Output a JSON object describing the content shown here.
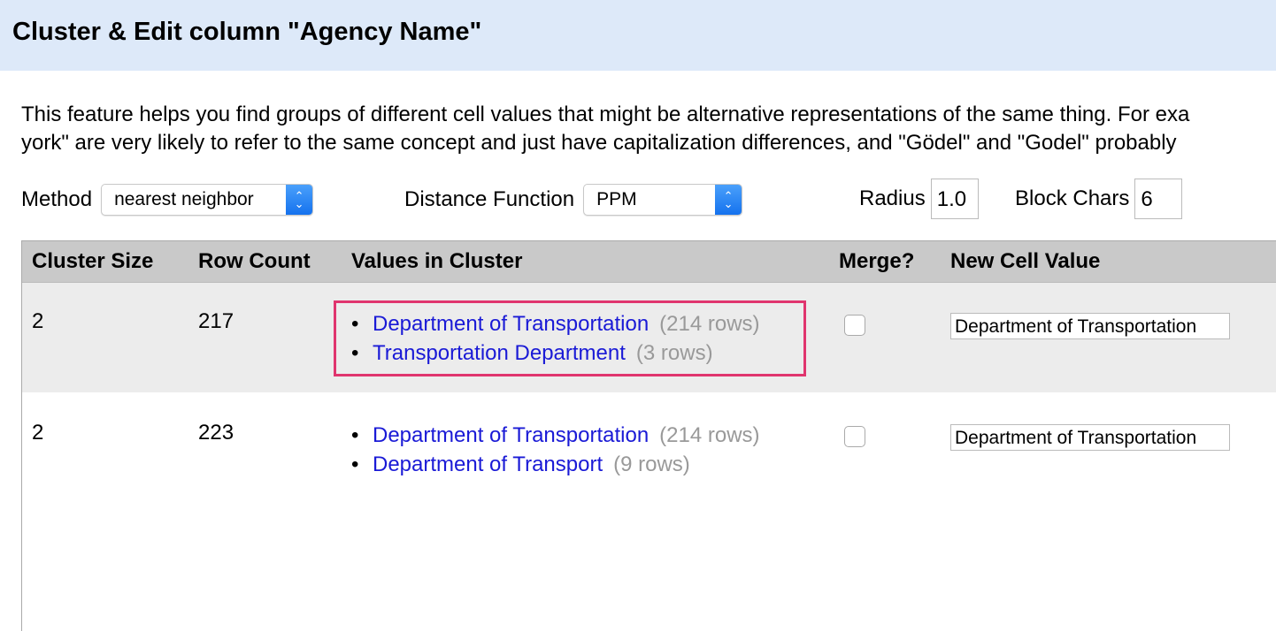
{
  "dialog": {
    "title": "Cluster & Edit column \"Agency Name\""
  },
  "description": {
    "line1": "This feature helps you find groups of different cell values that might be alternative representations of the same thing. For exa",
    "line2": "york\" are very likely to refer to the same concept and just have capitalization differences, and \"Gödel\" and \"Godel\" probably"
  },
  "controls": {
    "method_label": "Method",
    "method_value": "nearest neighbor",
    "distance_label": "Distance Function",
    "distance_value": "PPM",
    "radius_label": "Radius",
    "radius_value": "1.0",
    "block_label": "Block Chars",
    "block_value": "6"
  },
  "table": {
    "headers": [
      "Cluster Size",
      "Row Count",
      "Values in Cluster",
      "Merge?",
      "New Cell Value"
    ],
    "rows": [
      {
        "size": "2",
        "count": "217",
        "values": [
          {
            "name": "Department of Transportation",
            "rows": "(214 rows)"
          },
          {
            "name": "Transportation Department",
            "rows": "(3 rows)"
          }
        ],
        "merge": false,
        "new_value": "Department of Transportation"
      },
      {
        "size": "2",
        "count": "223",
        "values": [
          {
            "name": "Department of Transportation",
            "rows": "(214 rows)"
          },
          {
            "name": "Department of Transport",
            "rows": "(9 rows)"
          }
        ],
        "merge": false,
        "new_value": "Department of Transportation"
      }
    ]
  },
  "colors": {
    "header_bg": "#dde9f9",
    "link": "#1a1ad6",
    "highlight": "#e0356e"
  }
}
